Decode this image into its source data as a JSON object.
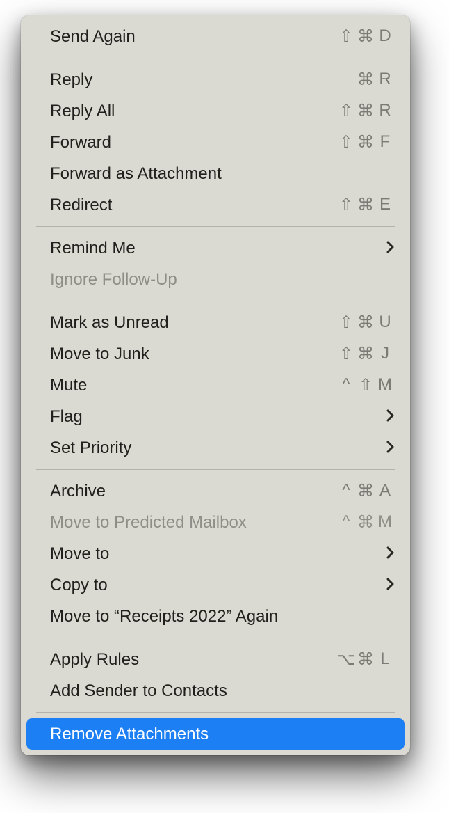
{
  "menu": {
    "groups": [
      [
        {
          "id": "send-again",
          "label": "Send Again",
          "shortcut": "⇧⌘D"
        }
      ],
      [
        {
          "id": "reply",
          "label": "Reply",
          "shortcut": "⌘R"
        },
        {
          "id": "reply-all",
          "label": "Reply All",
          "shortcut": "⇧⌘R"
        },
        {
          "id": "forward",
          "label": "Forward",
          "shortcut": "⇧⌘F"
        },
        {
          "id": "forward-as-attachment",
          "label": "Forward as Attachment"
        },
        {
          "id": "redirect",
          "label": "Redirect",
          "shortcut": "⇧⌘E"
        }
      ],
      [
        {
          "id": "remind-me",
          "label": "Remind Me",
          "submenu": true
        },
        {
          "id": "ignore-follow-up",
          "label": "Ignore Follow-Up",
          "disabled": true
        }
      ],
      [
        {
          "id": "mark-as-unread",
          "label": "Mark as Unread",
          "shortcut": "⇧⌘U"
        },
        {
          "id": "move-to-junk",
          "label": "Move to Junk",
          "shortcut": "⇧⌘J"
        },
        {
          "id": "mute",
          "label": "Mute",
          "shortcut": "^⇧M"
        },
        {
          "id": "flag",
          "label": "Flag",
          "submenu": true
        },
        {
          "id": "set-priority",
          "label": "Set Priority",
          "submenu": true
        }
      ],
      [
        {
          "id": "archive",
          "label": "Archive",
          "shortcut": "^⌘A"
        },
        {
          "id": "move-to-predicted",
          "label": "Move to Predicted Mailbox",
          "shortcut": "^⌘M",
          "disabled": true
        },
        {
          "id": "move-to",
          "label": "Move to",
          "submenu": true
        },
        {
          "id": "copy-to",
          "label": "Copy to",
          "submenu": true
        },
        {
          "id": "move-to-again",
          "label": "Move to “Receipts 2022” Again"
        }
      ],
      [
        {
          "id": "apply-rules",
          "label": "Apply Rules",
          "shortcut": "⌥⌘L"
        },
        {
          "id": "add-sender-to-contacts",
          "label": "Add Sender to Contacts"
        }
      ],
      [
        {
          "id": "remove-attachments",
          "label": "Remove Attachments",
          "highlight": true
        }
      ]
    ]
  }
}
